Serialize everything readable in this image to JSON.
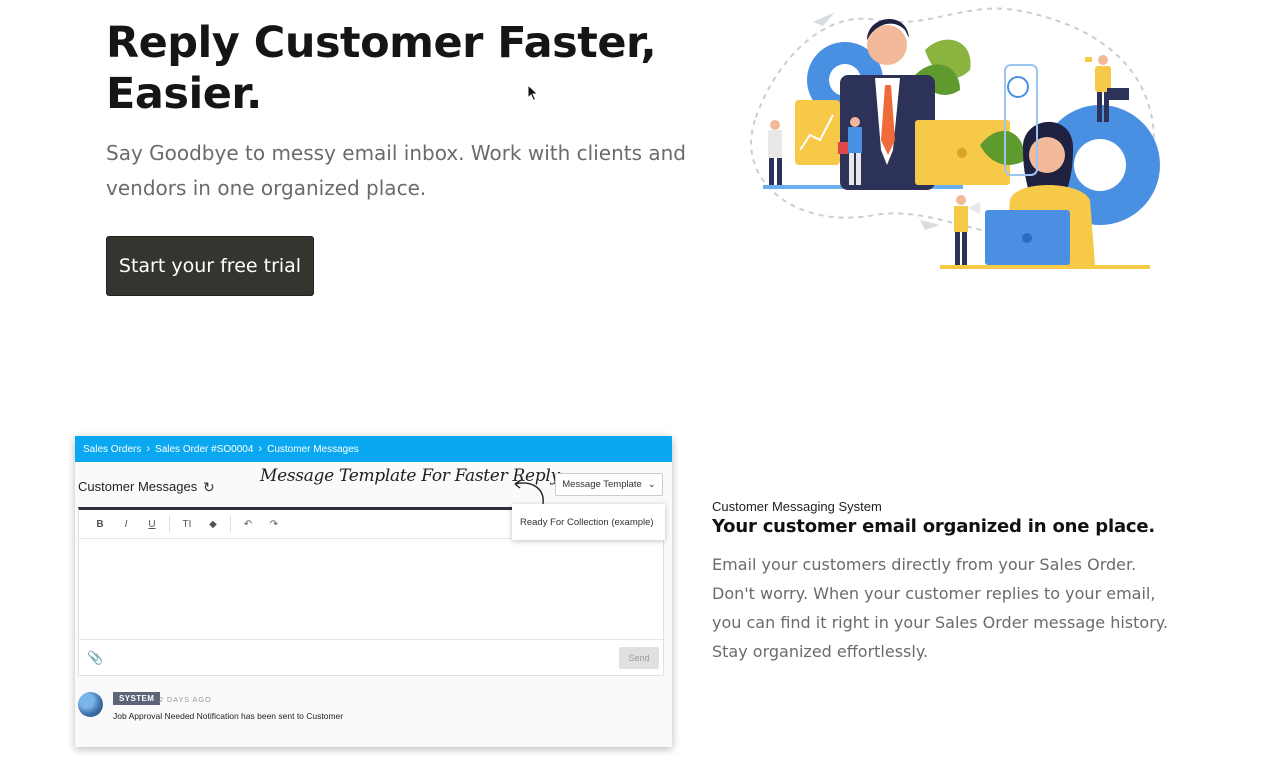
{
  "hero": {
    "title": "Reply Customer Faster, Easier.",
    "subtitle": "Say Goodbye to messy email inbox. Work with clients and vendors in one organized place.",
    "cta_label": "Start your free trial"
  },
  "screenshot": {
    "breadcrumb": [
      "Sales Orders",
      "Sales Order #SO0004",
      "Customer Messages"
    ],
    "section_title": "Customer Messages",
    "annotation": "Message Template For Faster Reply",
    "template_button": "Message Template",
    "template_option": "Ready For Collection (example)",
    "toolbar": [
      "B",
      "I",
      "U",
      "TI",
      "◆",
      "↶",
      "↷"
    ],
    "send_label": "Send",
    "message": {
      "badge": "SYSTEM",
      "time": "2 DAYS AGO",
      "text": "Job Approval Needed Notification has been sent to Customer"
    }
  },
  "feature": {
    "eyebrow": "Customer Messaging System",
    "title": "Your customer email organized in one place.",
    "body": "Email your customers directly from your Sales Order. Don't worry. When your customer replies to your email, you can find it right in your Sales Order message history. Stay organized effortlessly."
  },
  "colors": {
    "cta_bg": "#353530",
    "breadcrumb_bar": "#0aa8f0",
    "badge_bg": "#5d6479"
  }
}
